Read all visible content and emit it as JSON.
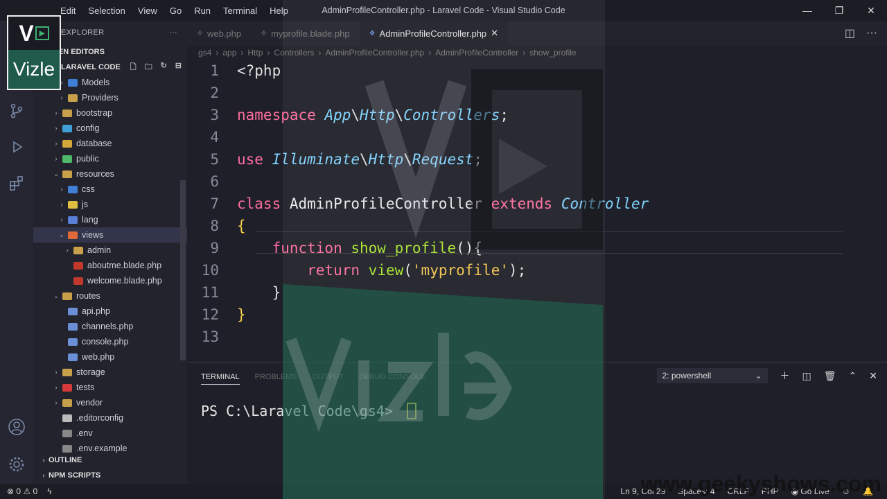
{
  "titlebar": {
    "menu": [
      "Edit",
      "Selection",
      "View",
      "Go",
      "Run",
      "Terminal",
      "Help"
    ],
    "window_title": "AdminProfileController.php - Laravel Code - Visual Studio Code"
  },
  "sidebar": {
    "header": "EXPLORER",
    "open_editors": "OPEN EDITORS",
    "project": "LARAVEL CODE",
    "tree": [
      {
        "label": "Models",
        "depth": 2,
        "chev": "›",
        "color": "#3f7fd6"
      },
      {
        "label": "Providers",
        "depth": 2,
        "chev": "›",
        "color": "#c9a04a"
      },
      {
        "label": "bootstrap",
        "depth": 1,
        "chev": "›",
        "color": "#c9a04a"
      },
      {
        "label": "config",
        "depth": 1,
        "chev": "›",
        "color": "#3f9fd6"
      },
      {
        "label": "database",
        "depth": 1,
        "chev": "›",
        "color": "#d4a73a"
      },
      {
        "label": "public",
        "depth": 1,
        "chev": "›",
        "color": "#4fb86a"
      },
      {
        "label": "resources",
        "depth": 1,
        "chev": "⌄",
        "color": "#c9a04a"
      },
      {
        "label": "css",
        "depth": 2,
        "chev": "›",
        "color": "#3f7fd6"
      },
      {
        "label": "js",
        "depth": 2,
        "chev": "›",
        "color": "#e0c040"
      },
      {
        "label": "lang",
        "depth": 2,
        "chev": "›",
        "color": "#5a7fd6"
      },
      {
        "label": "views",
        "depth": 2,
        "chev": "⌄",
        "color": "#e06a3a",
        "selected": true
      },
      {
        "label": "admin",
        "depth": 3,
        "chev": "›",
        "color": "#c9a04a"
      },
      {
        "label": "aboutme.blade.php",
        "depth": 3,
        "chev": "",
        "color": "#c0392b"
      },
      {
        "label": "welcome.blade.php",
        "depth": 3,
        "chev": "",
        "color": "#c0392b"
      },
      {
        "label": "routes",
        "depth": 1,
        "chev": "⌄",
        "color": "#c9a04a"
      },
      {
        "label": "api.php",
        "depth": 2,
        "chev": "",
        "color": "#6a8fd6"
      },
      {
        "label": "channels.php",
        "depth": 2,
        "chev": "",
        "color": "#6a8fd6"
      },
      {
        "label": "console.php",
        "depth": 2,
        "chev": "",
        "color": "#6a8fd6"
      },
      {
        "label": "web.php",
        "depth": 2,
        "chev": "",
        "color": "#6a8fd6"
      },
      {
        "label": "storage",
        "depth": 1,
        "chev": "›",
        "color": "#c9a04a"
      },
      {
        "label": "tests",
        "depth": 1,
        "chev": "›",
        "color": "#d63a3a"
      },
      {
        "label": "vendor",
        "depth": 1,
        "chev": "›",
        "color": "#c9a04a"
      },
      {
        "label": ".editorconfig",
        "depth": 1,
        "chev": "",
        "color": "#bbbbbb"
      },
      {
        "label": ".env",
        "depth": 1,
        "chev": "",
        "color": "#888888"
      },
      {
        "label": ".env.example",
        "depth": 1,
        "chev": "",
        "color": "#888888"
      }
    ],
    "outline": "OUTLINE",
    "npm": "NPM SCRIPTS"
  },
  "tabs": [
    {
      "label": "web.php",
      "active": false
    },
    {
      "label": "myprofile.blade.php",
      "active": false
    },
    {
      "label": "AdminProfileController.php",
      "active": true
    }
  ],
  "breadcrumb": [
    "gs4",
    "app",
    "Http",
    "Controllers",
    "AdminProfileController.php",
    "AdminProfileController",
    "show_profile"
  ],
  "code_lines": [
    [
      [
        "pl",
        "<?php"
      ]
    ],
    [],
    [
      [
        "kw",
        "namespace "
      ],
      [
        "ns",
        "App"
      ],
      [
        "pl",
        "\\"
      ],
      [
        "ns",
        "Http"
      ],
      [
        "pl",
        "\\"
      ],
      [
        "ns",
        "Controllers"
      ],
      [
        "pl",
        ";"
      ]
    ],
    [],
    [
      [
        "kw",
        "use "
      ],
      [
        "ns",
        "Illuminate"
      ],
      [
        "pl",
        "\\"
      ],
      [
        "ns",
        "Http"
      ],
      [
        "pl",
        "\\"
      ],
      [
        "ns",
        "Request"
      ],
      [
        "pl",
        ";"
      ]
    ],
    [],
    [
      [
        "kw",
        "class "
      ],
      [
        "cls",
        "AdminProfileController "
      ],
      [
        "kw",
        "extends "
      ],
      [
        "ns",
        "Controller"
      ]
    ],
    [
      [
        "br1",
        "{"
      ]
    ],
    [
      [
        "pl",
        "    "
      ],
      [
        "kw",
        "function "
      ],
      [
        "fn",
        "show_profile"
      ],
      [
        "pl",
        "(){"
      ]
    ],
    [
      [
        "pl",
        "        "
      ],
      [
        "kw",
        "return "
      ],
      [
        "fn",
        "view"
      ],
      [
        "pl",
        "("
      ],
      [
        "str",
        "'myprofile'"
      ],
      [
        "pl",
        ");"
      ]
    ],
    [
      [
        "pl",
        "    }"
      ]
    ],
    [
      [
        "br1",
        "}"
      ]
    ],
    []
  ],
  "panel": {
    "tabs": [
      "TERMINAL",
      "PROBLEMS",
      "OUTPUT",
      "DEBUG CONSOLE"
    ],
    "select": "2: powershell",
    "prompt": "PS C:\\Laravel Code\\gs4> "
  },
  "status": {
    "errors": "0",
    "warnings": "0",
    "position": "Ln 9, Col 29",
    "spaces": "Spaces: 4",
    "eol": "CRLF",
    "lang": "PHP",
    "golive": "Go Live"
  },
  "watermark": {
    "logo_top": "V",
    "logo_bottom": "Vizle",
    "site": "www.geekyshows.com"
  }
}
